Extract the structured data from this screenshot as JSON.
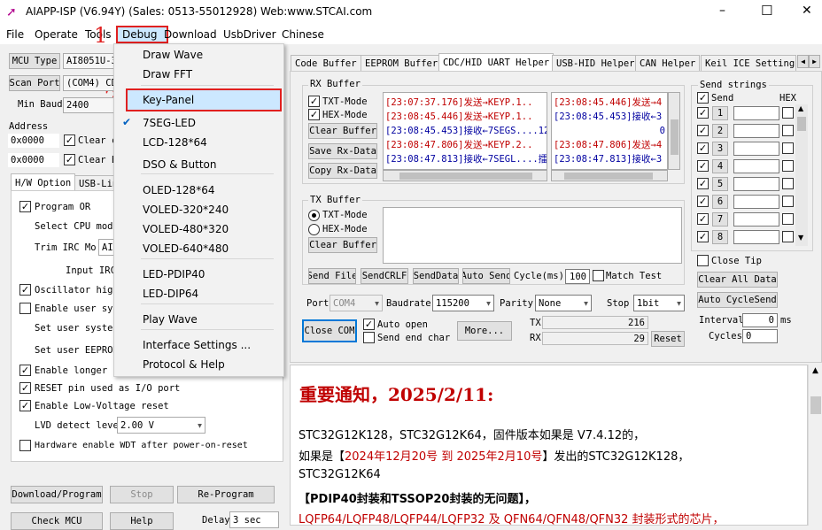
{
  "window": {
    "title": "AIAPP-ISP (V6.94Y) (Sales: 0513-55012928) Web:www.STCAI.com",
    "minimize": "–",
    "maximize": "☐",
    "close": "✕"
  },
  "menubar": [
    "File",
    "Operate",
    "Tools",
    "Debug",
    "Download",
    "UsbDriver",
    "Chinese"
  ],
  "annotations": {
    "step1": "1",
    "step2": "2"
  },
  "debug_menu": {
    "items": [
      {
        "label": "Draw Wave",
        "checked": false
      },
      {
        "label": "Draw FFT",
        "checked": false
      },
      {
        "label": "Key-Panel",
        "checked": false
      },
      {
        "label": "7SEG-LED",
        "checked": true
      },
      {
        "label": "LCD-128*64",
        "checked": false
      },
      {
        "label": "DSO & Button",
        "checked": false
      },
      {
        "label": "OLED-128*64",
        "checked": false
      },
      {
        "label": "VOLED-320*240",
        "checked": false
      },
      {
        "label": "VOLED-480*320",
        "checked": false
      },
      {
        "label": "VOLED-640*480",
        "checked": false
      },
      {
        "label": "LED-PDIP40",
        "checked": false
      },
      {
        "label": "LED-DIP64",
        "checked": false
      },
      {
        "label": "Play Wave",
        "checked": false
      },
      {
        "label": "Interface Settings ...",
        "checked": false
      },
      {
        "label": "Protocol & Help",
        "checked": false
      }
    ],
    "check_glyph": "✔"
  },
  "left": {
    "mcu_type_btn": "MCU Type",
    "mcu_type_value": "AI8051U-3",
    "scan_port_btn": "Scan Port",
    "scan_port_value": "(COM4) CD",
    "min_baud_label": "Min Baud",
    "min_baud_value": "2400",
    "address_label": "Address",
    "addr1": "0x0000",
    "addr2": "0x0000",
    "clear1": "Clear c",
    "clear2": "Clear E",
    "tabs": [
      "H/W Option",
      "USB-Lin"
    ],
    "options": [
      {
        "label": "Program OR",
        "checked": true
      },
      {
        "label": "Select CPU mode",
        "checked": null
      },
      {
        "label": "Trim IRC Mo",
        "checked": null
      },
      {
        "label": "Input IRC",
        "checked": null
      },
      {
        "label": "Oscillator high",
        "checked": true
      },
      {
        "label": "Enable user sys",
        "checked": false
      },
      {
        "label": "Set user system",
        "checked": null
      },
      {
        "label": "Set user EEPROM",
        "checked": null
      },
      {
        "label": "Enable longer p",
        "checked": true
      },
      {
        "label": "RESET pin used as I/O port",
        "checked": true
      },
      {
        "label": "Enable Low-Voltage reset",
        "checked": true
      },
      {
        "label": "LVD detect leve",
        "checked": null
      },
      {
        "label": "Hardware enable WDT after power-on-reset",
        "checked": false
      }
    ],
    "trim_value": "AI",
    "lvd_value": "2.00 V",
    "download_btn": "Download/Program",
    "stop_btn": "Stop",
    "reprogram_btn": "Re-Program",
    "check_btn": "Check MCU",
    "help_btn": "Help",
    "delay_label": "Delay",
    "delay_value": "3 sec"
  },
  "tabs": [
    "Code Buffer",
    "EEPROM Buffer",
    "CDC/HID UART Helper",
    "USB-HID Helper",
    "CAN Helper",
    "Keil ICE Settings"
  ],
  "uart": {
    "rx_title": "RX Buffer",
    "rx_txt_mode": "TXT-Mode",
    "rx_hex_mode": "HEX-Mode",
    "clear_buffer": "Clear Buffer",
    "save_rx": "Save Rx-Data",
    "copy_rx": "Copy Rx-Data",
    "rx_log": [
      {
        "text": "[23:07:37.176]发送→KEYP.1..",
        "color": "#c00000"
      },
      {
        "text": "[23:08:45.446]发送→KEYP.1..",
        "color": "#c00000"
      },
      {
        "text": "[23:08:45.453]接收←7SEGS....12",
        "color": "#0000a0"
      },
      {
        "text": "[23:08:47.806]发送→KEYP.2..",
        "color": "#c00000"
      },
      {
        "text": "[23:08:47.813]接收←7SEGL....擂",
        "color": "#0000a0"
      }
    ],
    "rx_log2": [
      {
        "text": "[23:08:45.446]发送→4",
        "color": "#c00000"
      },
      {
        "text": "[23:08:45.453]接收←3",
        "color": "#0000a0"
      },
      {
        "text": "0",
        "color": "#0000a0"
      },
      {
        "text": "[23:08:47.806]发送→4",
        "color": "#c00000"
      },
      {
        "text": "[23:08:47.813]接收←3",
        "color": "#0000a0"
      }
    ],
    "tx_title": "TX Buffer",
    "tx_txt_mode": "TXT-Mode",
    "tx_hex_mode": "HEX-Mode",
    "tx_clear": "Clear Buffer",
    "send_file": "Send File",
    "send_crlf": "SendCRLF",
    "send_data": "SendData",
    "auto_send": "Auto Send",
    "cycle_label": "Cycle(ms)",
    "cycle_value": "100",
    "match_test": "Match Test",
    "port_label": "Port",
    "port_value": "COM4",
    "baud_label": "Baudrate",
    "baud_value": "115200",
    "parity_label": "Parity",
    "parity_value": "None",
    "stop_label": "Stop",
    "stop_value": "1bit",
    "close_com": "Close COM",
    "auto_open": "Auto open",
    "send_end_char": "Send end char",
    "more": "More...",
    "tx_label": "TX",
    "tx_count": "216",
    "rx_label": "RX",
    "rx_count": "29",
    "reset": "Reset"
  },
  "send_strings": {
    "title": "Send strings",
    "send_header": "Send",
    "hex_header": "HEX",
    "rows": [
      "1",
      "2",
      "3",
      "4",
      "5",
      "6",
      "7",
      "8"
    ],
    "close_tip": "Close Tip",
    "clear_all": "Clear All Data",
    "auto_cycle": "Auto CycleSend",
    "interval_label": "Interval",
    "interval_value": "0",
    "interval_unit": "ms",
    "cycles_label": "Cycles",
    "cycles_value": "0"
  },
  "notice": {
    "title": "重要通知，2025/2/11:",
    "line1": "STC32G12K128，STC32G12K64，固件版本如果是 V7.4.12的，",
    "line2_a": "如果是【",
    "line2_red": "2024年12月20号 到 2025年2月10号",
    "line2_b": "】发出的STC32G12K128，",
    "line3": "STC32G12K64",
    "line4": "【PDIP40封装和TSSOP20封装的无问题】，",
    "line5": "LQFP64/LQFP48/LQFP44/LQFP32 及 QFN64/QFN48/QFN32 封装形式的芯片，"
  }
}
